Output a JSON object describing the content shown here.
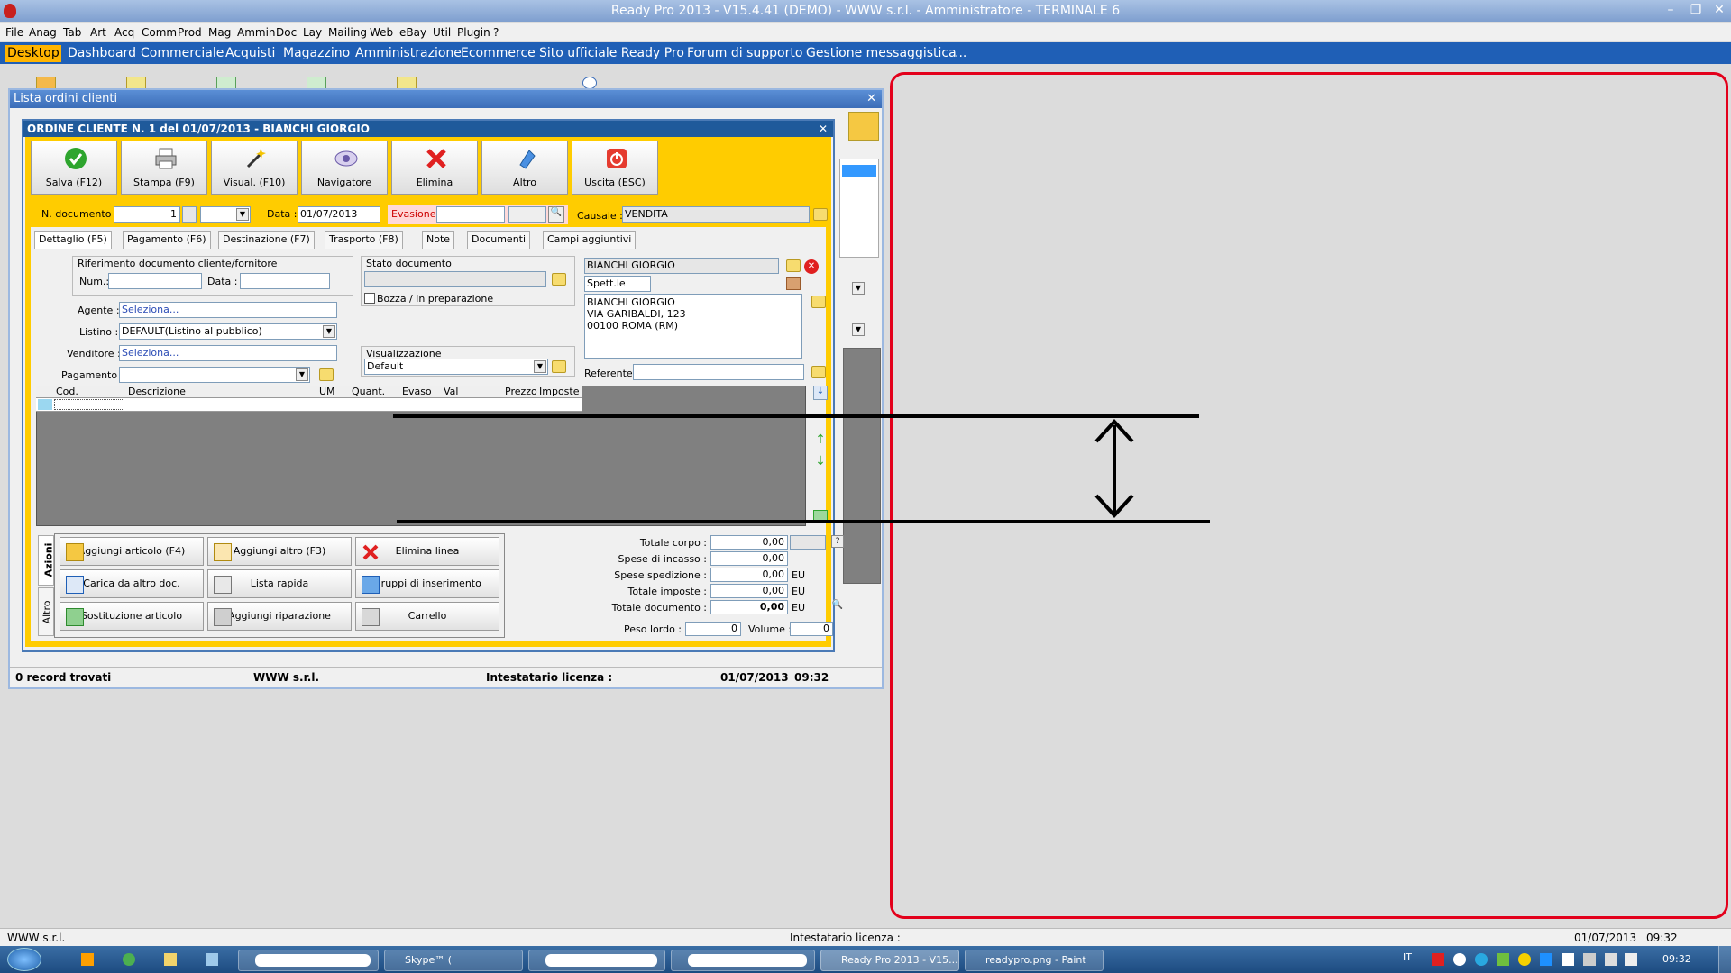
{
  "app": {
    "title": "Ready Pro 2013 - V15.4.41 (DEMO)  - WWW s.r.l. - Amministratore - TERMINALE 6"
  },
  "menu": [
    "File",
    "Anag",
    "Tab",
    "Art",
    "Acq",
    "Comm",
    "Prod",
    "Mag",
    "Ammin",
    "Doc",
    "Lay",
    "Mailing",
    "Web",
    "eBay",
    "Util",
    "Plugin",
    "?"
  ],
  "tabs": [
    {
      "label": "Desktop",
      "selected": true
    },
    {
      "label": "Dashboard"
    },
    {
      "label": "Commerciale"
    },
    {
      "label": "Acquisti"
    },
    {
      "label": "Magazzino"
    },
    {
      "label": "Amministrazione"
    },
    {
      "label": "Ecommerce"
    },
    {
      "label": "Sito ufficiale Ready Pro"
    },
    {
      "label": "Forum di supporto"
    },
    {
      "label": "Gestione messaggistica"
    },
    {
      "label": "..."
    }
  ],
  "list_window": {
    "title": "Lista ordini clienti",
    "status": {
      "records": "0 record trovati",
      "company": "WWW s.r.l.",
      "license": "Intestatario licenza :",
      "date": "01/07/2013",
      "time": "09:32"
    }
  },
  "order": {
    "title": "ORDINE CLIENTE N. 1 del 01/07/2013 - BIANCHI GIORGIO",
    "toolbar": [
      "Salva (F12)",
      "Stampa (F9)",
      "Visual. (F10)",
      "Navigatore",
      "Elimina",
      "Altro",
      "Uscita (ESC)"
    ],
    "fields": {
      "ndoc_label": "N. documento :",
      "ndoc_value": "1",
      "data_label": "Data :",
      "data_value": "01/07/2013",
      "evasione_label": "Evasione:",
      "causale_label": "Causale :",
      "causale_value": "VENDITA"
    },
    "subtabs": [
      "Dettaglio (F5)",
      "Pagamento (F6)",
      "Destinazione (F7)",
      "Trasporto (F8)",
      "Note",
      "Documenti",
      "Campi aggiuntivi"
    ],
    "rif": {
      "group": "Riferimento documento cliente/fornitore",
      "num": "Num.:",
      "data": "Data :"
    },
    "stato": {
      "group": "Stato documento",
      "bozza": "Bozza / in preparazione"
    },
    "visual": {
      "group": "Visualizzazione",
      "value": "Default"
    },
    "agente": {
      "label": "Agente :",
      "value": "Seleziona..."
    },
    "listino": {
      "label": "Listino :",
      "value": "DEFAULT(Listino al pubblico)"
    },
    "venditore": {
      "label": "Venditore :",
      "value": "Seleziona..."
    },
    "pagamento": {
      "label": "Pagamento :"
    },
    "customer": {
      "name": "BIANCHI GIORGIO",
      "title": "Spett.le",
      "address": [
        "BIANCHI GIORGIO",
        "VIA GARIBALDI, 123",
        "00100 ROMA (RM)"
      ],
      "referente": "Referente"
    },
    "grid_cols": [
      "Cod.",
      "Descrizione",
      "UM",
      "Quant.",
      "Evaso",
      "Val",
      "Prezzo",
      "Imposte"
    ],
    "side_tabs": [
      "Azioni",
      "Altro"
    ],
    "actions": [
      "Aggiungi articolo (F4)",
      "Aggiungi altro (F3)",
      "Elimina linea",
      "Carica da altro doc.",
      "Lista rapida",
      "Gruppi di inserimento",
      "Sostituzione articolo",
      "Aggiungi riparazione",
      "Carrello"
    ],
    "totals": [
      {
        "label": "Totale corpo :",
        "value": "0,00",
        "unit": ""
      },
      {
        "label": "Spese di incasso :",
        "value": "0,00",
        "unit": ""
      },
      {
        "label": "Spese spedizione :",
        "value": "0,00",
        "unit": "EU"
      },
      {
        "label": "Totale imposte :",
        "value": "0,00",
        "unit": "EU"
      },
      {
        "label": "Totale documento :",
        "value": "0,00",
        "unit": "EU"
      }
    ],
    "peso": {
      "label": "Peso lordo :",
      "value": "0"
    },
    "volume": {
      "label": "Volume :",
      "value": "0"
    },
    "help": "?"
  },
  "bottom_status": {
    "company": "WWW s.r.l.",
    "license": "Intestatario licenza :",
    "date": "01/07/2013",
    "time": "09:32"
  },
  "taskbar": {
    "items": [
      "Skype™ (",
      "Ready Pro 2013 - V15...",
      "readypro.png - Paint"
    ],
    "lang": "IT",
    "time": "09:32"
  },
  "colors": {
    "annotation_red": "#e3001b",
    "accent_yellow": "#ffcc00",
    "tab_blue": "#1f5fb6"
  }
}
